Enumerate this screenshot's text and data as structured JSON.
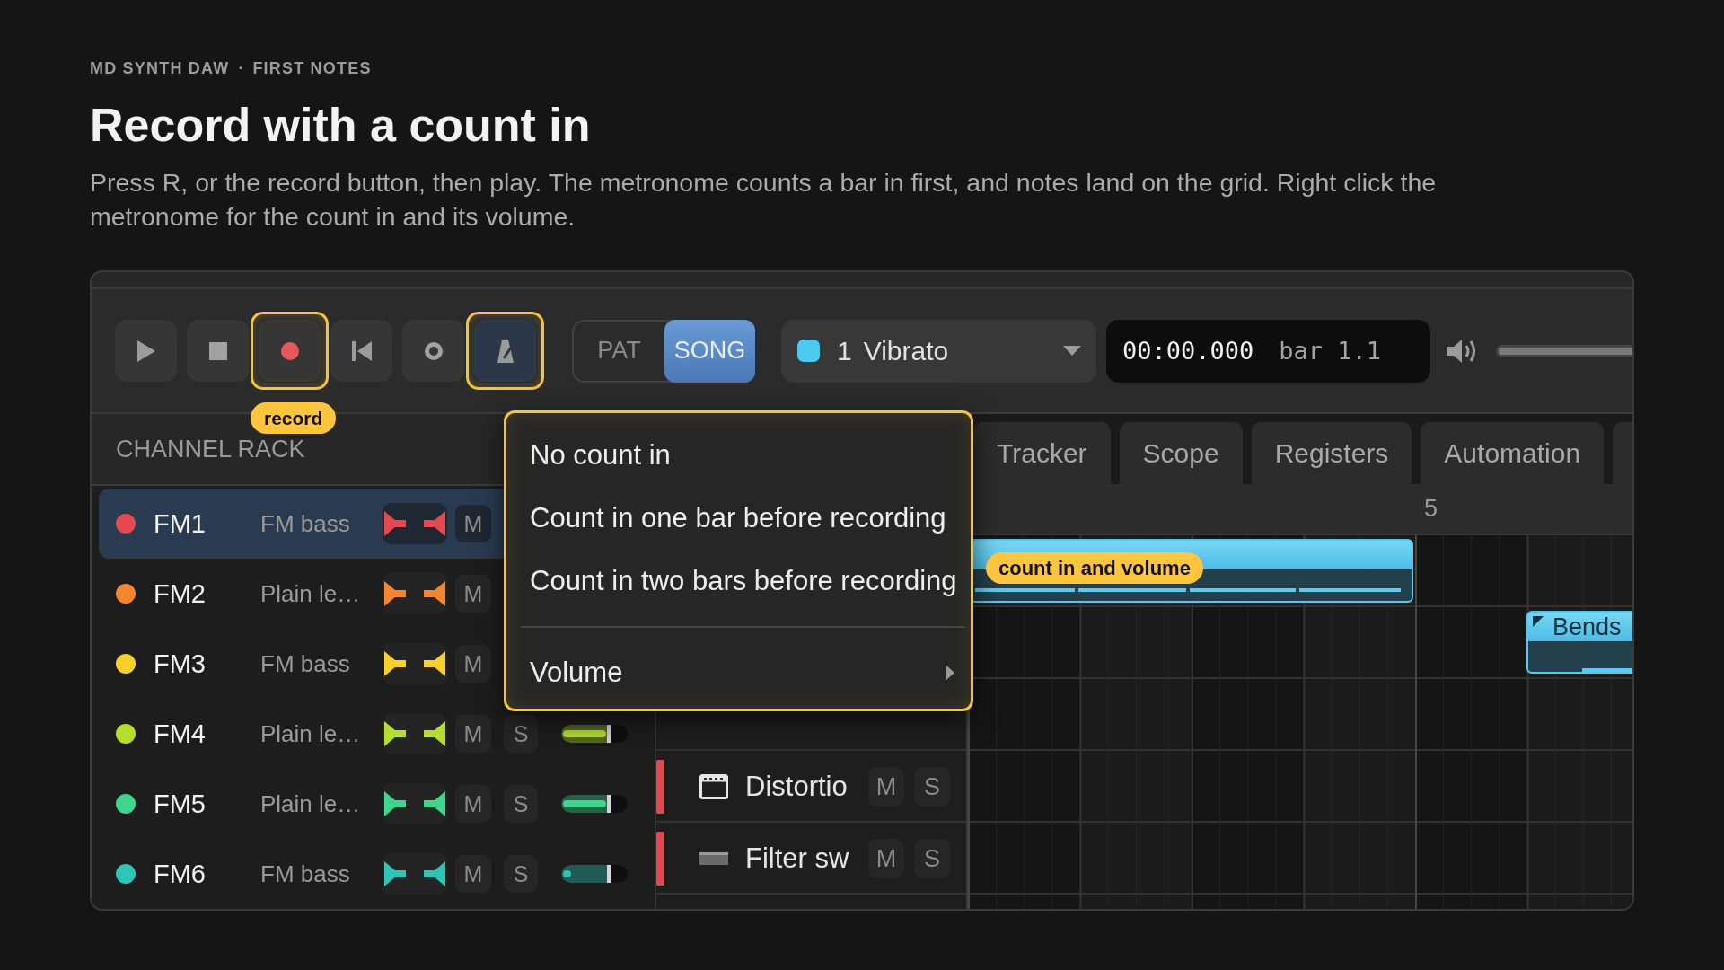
{
  "header": {
    "breadcrumb": [
      "MD SYNTH DAW",
      "FIRST NOTES"
    ],
    "separator": "·",
    "title": "Record with a count in",
    "description": "Press R, or the record button, then play. The metronome counts a bar in first, and notes land on the grid. Right click the metronome for the count in and its volume."
  },
  "toolbar": {
    "buttons": [
      {
        "kind": "play",
        "active": false,
        "highlighted": false
      },
      {
        "kind": "stop",
        "active": false,
        "highlighted": false
      },
      {
        "kind": "record",
        "active": false,
        "highlighted": true,
        "callout": "record"
      },
      {
        "kind": "rewind",
        "active": false,
        "highlighted": false
      },
      {
        "kind": "circle",
        "active": false,
        "highlighted": false
      },
      {
        "kind": "metronome",
        "active": true,
        "highlighted": true
      }
    ],
    "mode": [
      {
        "label": "PAT",
        "selected": false
      },
      {
        "label": "SONG",
        "selected": true
      }
    ],
    "pattern": {
      "color": "#4cc9f0",
      "number": "1",
      "name": "Vibrato"
    },
    "time": {
      "clock": "00:00.000",
      "position": "bar 1.1"
    },
    "volume": {
      "level": 1
    }
  },
  "channel_rack": {
    "title": "CHANNEL RACK",
    "channels": [
      {
        "name": "FM1",
        "preset": "FM bass",
        "color": "#e5484d",
        "selected": true,
        "mute": "M"
      },
      {
        "name": "FM2",
        "preset": "Plain le…",
        "color": "#f5862f",
        "selected": false,
        "mute": "M"
      },
      {
        "name": "FM3",
        "preset": "FM bass",
        "color": "#f9cf2a",
        "selected": false,
        "mute": "M"
      },
      {
        "name": "FM4",
        "preset": "Plain le…",
        "color": "#b5dd2d",
        "selected": false,
        "mute": "M",
        "solo": "S",
        "fader": {
          "level": 0.74
        },
        "meter": {
          "level": 0.7
        }
      },
      {
        "name": "FM5",
        "preset": "Plain le…",
        "color": "#3dd68c",
        "selected": false,
        "mute": "M",
        "solo": "S",
        "fader": {
          "level": 0.74
        },
        "meter": {
          "level": 0.7
        }
      },
      {
        "name": "FM6",
        "preset": "FM bass",
        "color": "#2ec4b6",
        "selected": false,
        "mute": "M",
        "solo": "S",
        "fader": {
          "level": 0.74
        },
        "meter": {
          "level": 0.13
        }
      }
    ]
  },
  "menu": {
    "highlighted": true,
    "callout": "count in and volume",
    "items": [
      {
        "kind": "item",
        "label": "No count in"
      },
      {
        "kind": "item",
        "label": "Count in one bar before recording"
      },
      {
        "kind": "item",
        "label": "Count in two bars before recording"
      },
      {
        "kind": "separator"
      },
      {
        "kind": "submenu",
        "label": "Volume"
      }
    ]
  },
  "playlist": {
    "tabs": [
      {
        "label": "Tracker",
        "selected": false
      },
      {
        "label": "Scope",
        "selected": false
      },
      {
        "label": "Registers",
        "selected": false
      },
      {
        "label": "Automation",
        "selected": false
      }
    ],
    "ruler": [
      "5"
    ],
    "tracks": [
      {
        "name": "Distortio",
        "kind": "framed",
        "color": "#e5484d",
        "mute": "M",
        "solo": "S"
      },
      {
        "name": "Filter sw",
        "kind": "plain",
        "color": "#e5484d",
        "mute": "M",
        "solo": "S"
      }
    ],
    "clips": [
      {
        "kind": "pattern"
      },
      {
        "kind": "pattern",
        "name": "Bends"
      }
    ]
  }
}
